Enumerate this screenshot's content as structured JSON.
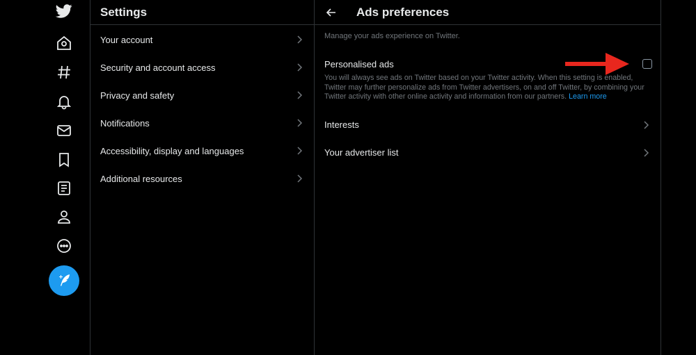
{
  "nav": {
    "icons": [
      "twitter-logo-icon",
      "home-icon",
      "explore-hashtag-icon",
      "notifications-bell-icon",
      "messages-mail-icon",
      "bookmarks-icon",
      "lists-icon",
      "profile-icon",
      "more-icon"
    ],
    "compose_icon": "compose-tweet-icon",
    "accent": "#1d9bf0"
  },
  "settings": {
    "title": "Settings",
    "items": [
      {
        "label": "Your account"
      },
      {
        "label": "Security and account access"
      },
      {
        "label": "Privacy and safety"
      },
      {
        "label": "Notifications"
      },
      {
        "label": "Accessibility, display and languages"
      },
      {
        "label": "Additional resources"
      }
    ]
  },
  "ads": {
    "title": "Ads preferences",
    "description": "Manage your ads experience on Twitter.",
    "personalised": {
      "label": "Personalised ads",
      "checked": false,
      "description": "You will always see ads on Twitter based on your Twitter activity. When this setting is enabled, Twitter may further personalize ads from Twitter advertisers, on and off Twitter, by combining your Twitter activity with other online activity and information from our partners.",
      "link": "Learn more"
    },
    "items": [
      {
        "label": "Interests"
      },
      {
        "label": "Your advertiser list"
      }
    ]
  },
  "annotation": {
    "arrow_color": "#e8271e"
  }
}
